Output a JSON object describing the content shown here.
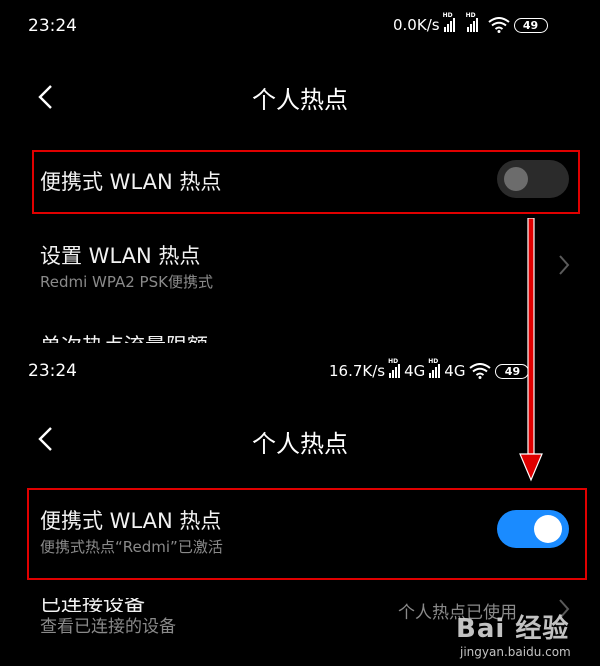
{
  "top": {
    "time": "23:24",
    "net_speed": "0.0K/s",
    "hd_label": "HD",
    "battery": "49",
    "title": "个人热点",
    "hotspot_label": "便携式 WLAN 热点",
    "toggle_state": "off",
    "setup_label": "设置 WLAN 热点",
    "setup_sub": "Redmi WPA2 PSK便携式",
    "cut_label": "单次热点流量限额"
  },
  "bottom": {
    "time": "23:24",
    "net_speed": "16.7K/s",
    "hd_label": "HD",
    "net_type": "4G",
    "battery": "49",
    "title": "个人热点",
    "hotspot_label": "便携式 WLAN 热点",
    "hotspot_sub": "便携式热点“Redmi”已激活",
    "toggle_state": "on",
    "devices_label": "已连接设备",
    "devices_sub": "查看已连接的设备",
    "devices_value": "个人热点已使用"
  },
  "watermark": {
    "brand": "Bai 经验",
    "url": "jingyan.baidu.com"
  },
  "colors": {
    "accent": "#1a8bff",
    "highlight": "#e00000",
    "toggle_off": "#2b2b2b"
  }
}
